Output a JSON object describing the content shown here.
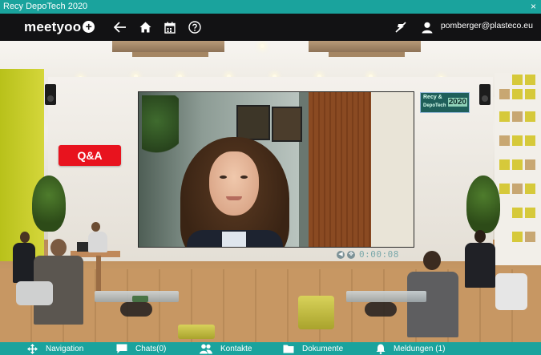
{
  "window": {
    "title": "Recy DepoTech 2020",
    "close_glyph": "×"
  },
  "topbar": {
    "logo_text": "meetyoo",
    "logo_plus": "+",
    "buttons": [
      "back-arrow-icon",
      "home-icon",
      "calendar-icon",
      "help-icon"
    ],
    "right_icons": [
      "mute-icon",
      "user-icon"
    ],
    "user_email": "pomberger@plasteco.eu"
  },
  "scene": {
    "qa_label": "Q&A",
    "video_timer": "0:00:08",
    "sign": {
      "line1": "Recy &",
      "line2": "DepoTech",
      "year": "2020"
    }
  },
  "bottom_nav": {
    "items": [
      {
        "label": "Navigation",
        "icon": "move-icon"
      },
      {
        "label": "Chats(0)",
        "icon": "chat-icon"
      },
      {
        "label": "Kontakte",
        "icon": "contacts-icon"
      },
      {
        "label": "Dokumente",
        "icon": "document-icon"
      },
      {
        "label": "Meldungen (1)",
        "icon": "bell-icon"
      }
    ]
  },
  "colors": {
    "accent": "#1aa39d",
    "qa": "#e8131e",
    "topbar": "#121214"
  }
}
